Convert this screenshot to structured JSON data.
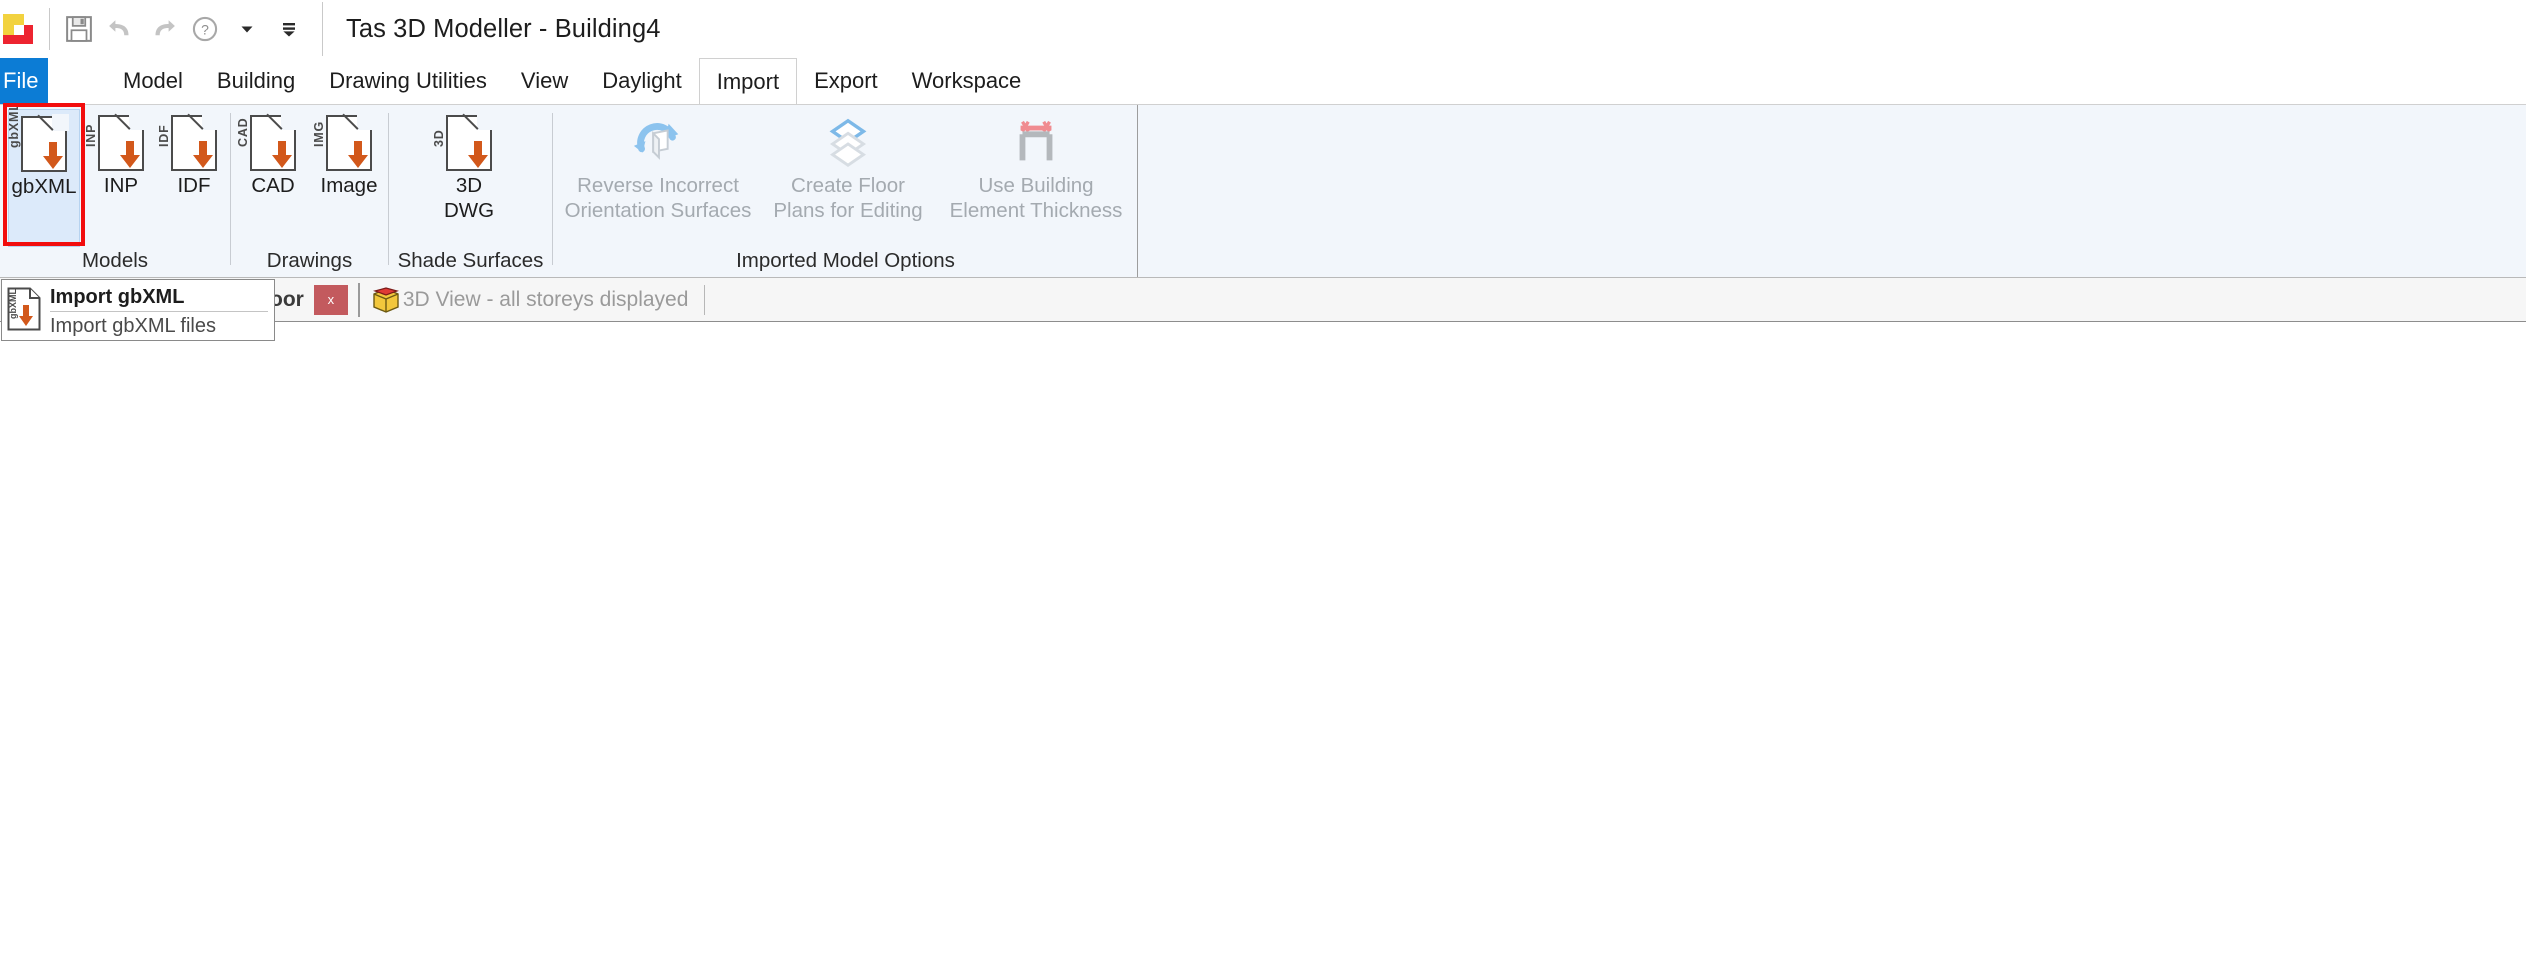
{
  "titlebar": {
    "app_logo_name": "tas-app-logo",
    "quick_access": [
      {
        "name": "save-icon",
        "label": "Save"
      },
      {
        "name": "undo-icon",
        "label": "Undo"
      },
      {
        "name": "redo-icon",
        "label": "Redo"
      },
      {
        "name": "help-icon",
        "label": "Help"
      },
      {
        "name": "chevron-down-icon",
        "label": "More"
      },
      {
        "name": "customize-quick-access-icon",
        "label": "Customize Quick Access Toolbar"
      }
    ],
    "title": "Tas 3D Modeller - Building4"
  },
  "menubar": {
    "file_label": "File",
    "items": [
      {
        "label": "Model",
        "active": false
      },
      {
        "label": "Building",
        "active": false
      },
      {
        "label": "Drawing Utilities",
        "active": false
      },
      {
        "label": "View",
        "active": false
      },
      {
        "label": "Daylight",
        "active": false
      },
      {
        "label": "Import",
        "active": true
      },
      {
        "label": "Export",
        "active": false
      },
      {
        "label": "Workspace",
        "active": false
      }
    ]
  },
  "ribbon": {
    "groups": [
      {
        "name": "models",
        "label": "Models",
        "buttons": [
          {
            "name": "import-gbxml-button",
            "label": "gbXML",
            "label2": "",
            "icon": "gbxml-file-import-icon",
            "icon_text": "gbXML",
            "enabled": true,
            "hovered": true
          },
          {
            "name": "import-inp-button",
            "label": "INP",
            "label2": "",
            "icon": "inp-file-import-icon",
            "icon_text": "INP",
            "enabled": true,
            "hovered": false
          },
          {
            "name": "import-idf-button",
            "label": "IDF",
            "label2": "",
            "icon": "idf-file-import-icon",
            "icon_text": "IDF",
            "enabled": true,
            "hovered": false
          }
        ]
      },
      {
        "name": "drawings",
        "label": "Drawings",
        "buttons": [
          {
            "name": "import-cad-button",
            "label": "CAD",
            "label2": "",
            "icon": "cad-file-import-icon",
            "icon_text": "CAD",
            "enabled": true,
            "hovered": false
          },
          {
            "name": "import-image-button",
            "label": "Image",
            "label2": "",
            "icon": "image-file-import-icon",
            "icon_text": "IMG",
            "enabled": true,
            "hovered": false
          }
        ]
      },
      {
        "name": "shade-surfaces",
        "label": "Shade Surfaces",
        "buttons": [
          {
            "name": "import-3d-dwg-button",
            "label": "3D",
            "label2": "DWG",
            "icon": "dwg-3d-file-import-icon",
            "icon_text": "3D",
            "enabled": true,
            "hovered": false
          }
        ]
      },
      {
        "name": "imported-model-options",
        "label": "Imported Model Options",
        "buttons": [
          {
            "name": "reverse-incorrect-orientation-surfaces-button",
            "label": "Reverse Incorrect",
            "label2": "Orientation Surfaces",
            "icon": "reverse-orientation-icon",
            "icon_text": "",
            "enabled": false,
            "hovered": false
          },
          {
            "name": "create-floor-plans-for-editing-button",
            "label": "Create Floor",
            "label2": "Plans for Editing",
            "icon": "create-floor-plans-icon",
            "icon_text": "",
            "enabled": false,
            "hovered": false
          },
          {
            "name": "use-building-element-thickness-button",
            "label": "Use Building",
            "label2": "Element Thickness",
            "icon": "building-element-thickness-icon",
            "icon_text": "",
            "enabled": false,
            "hovered": false
          }
        ]
      }
    ]
  },
  "tabbar": {
    "active_tab_label": "oor",
    "close_label": "x",
    "inactive_tab_label": "3D View - all storeys displayed",
    "cube_icon_name": "3d-view-cube-icon"
  },
  "tooltip": {
    "title": "Import gbXML",
    "description": "Import gbXML files",
    "icon_name": "gbxml-file-import-icon"
  },
  "annotation": {
    "name": "highlight-box-gbxml",
    "color": "#f20d0d"
  },
  "colors": {
    "accent_blue": "#0c7cd5",
    "ribbon_bg": "#f2f6fb",
    "hover_blue": "#dceafa",
    "arrow_orange": "#d2581b",
    "tab_close_red": "#c35a5e",
    "disabled_text": "#a4aab0"
  }
}
